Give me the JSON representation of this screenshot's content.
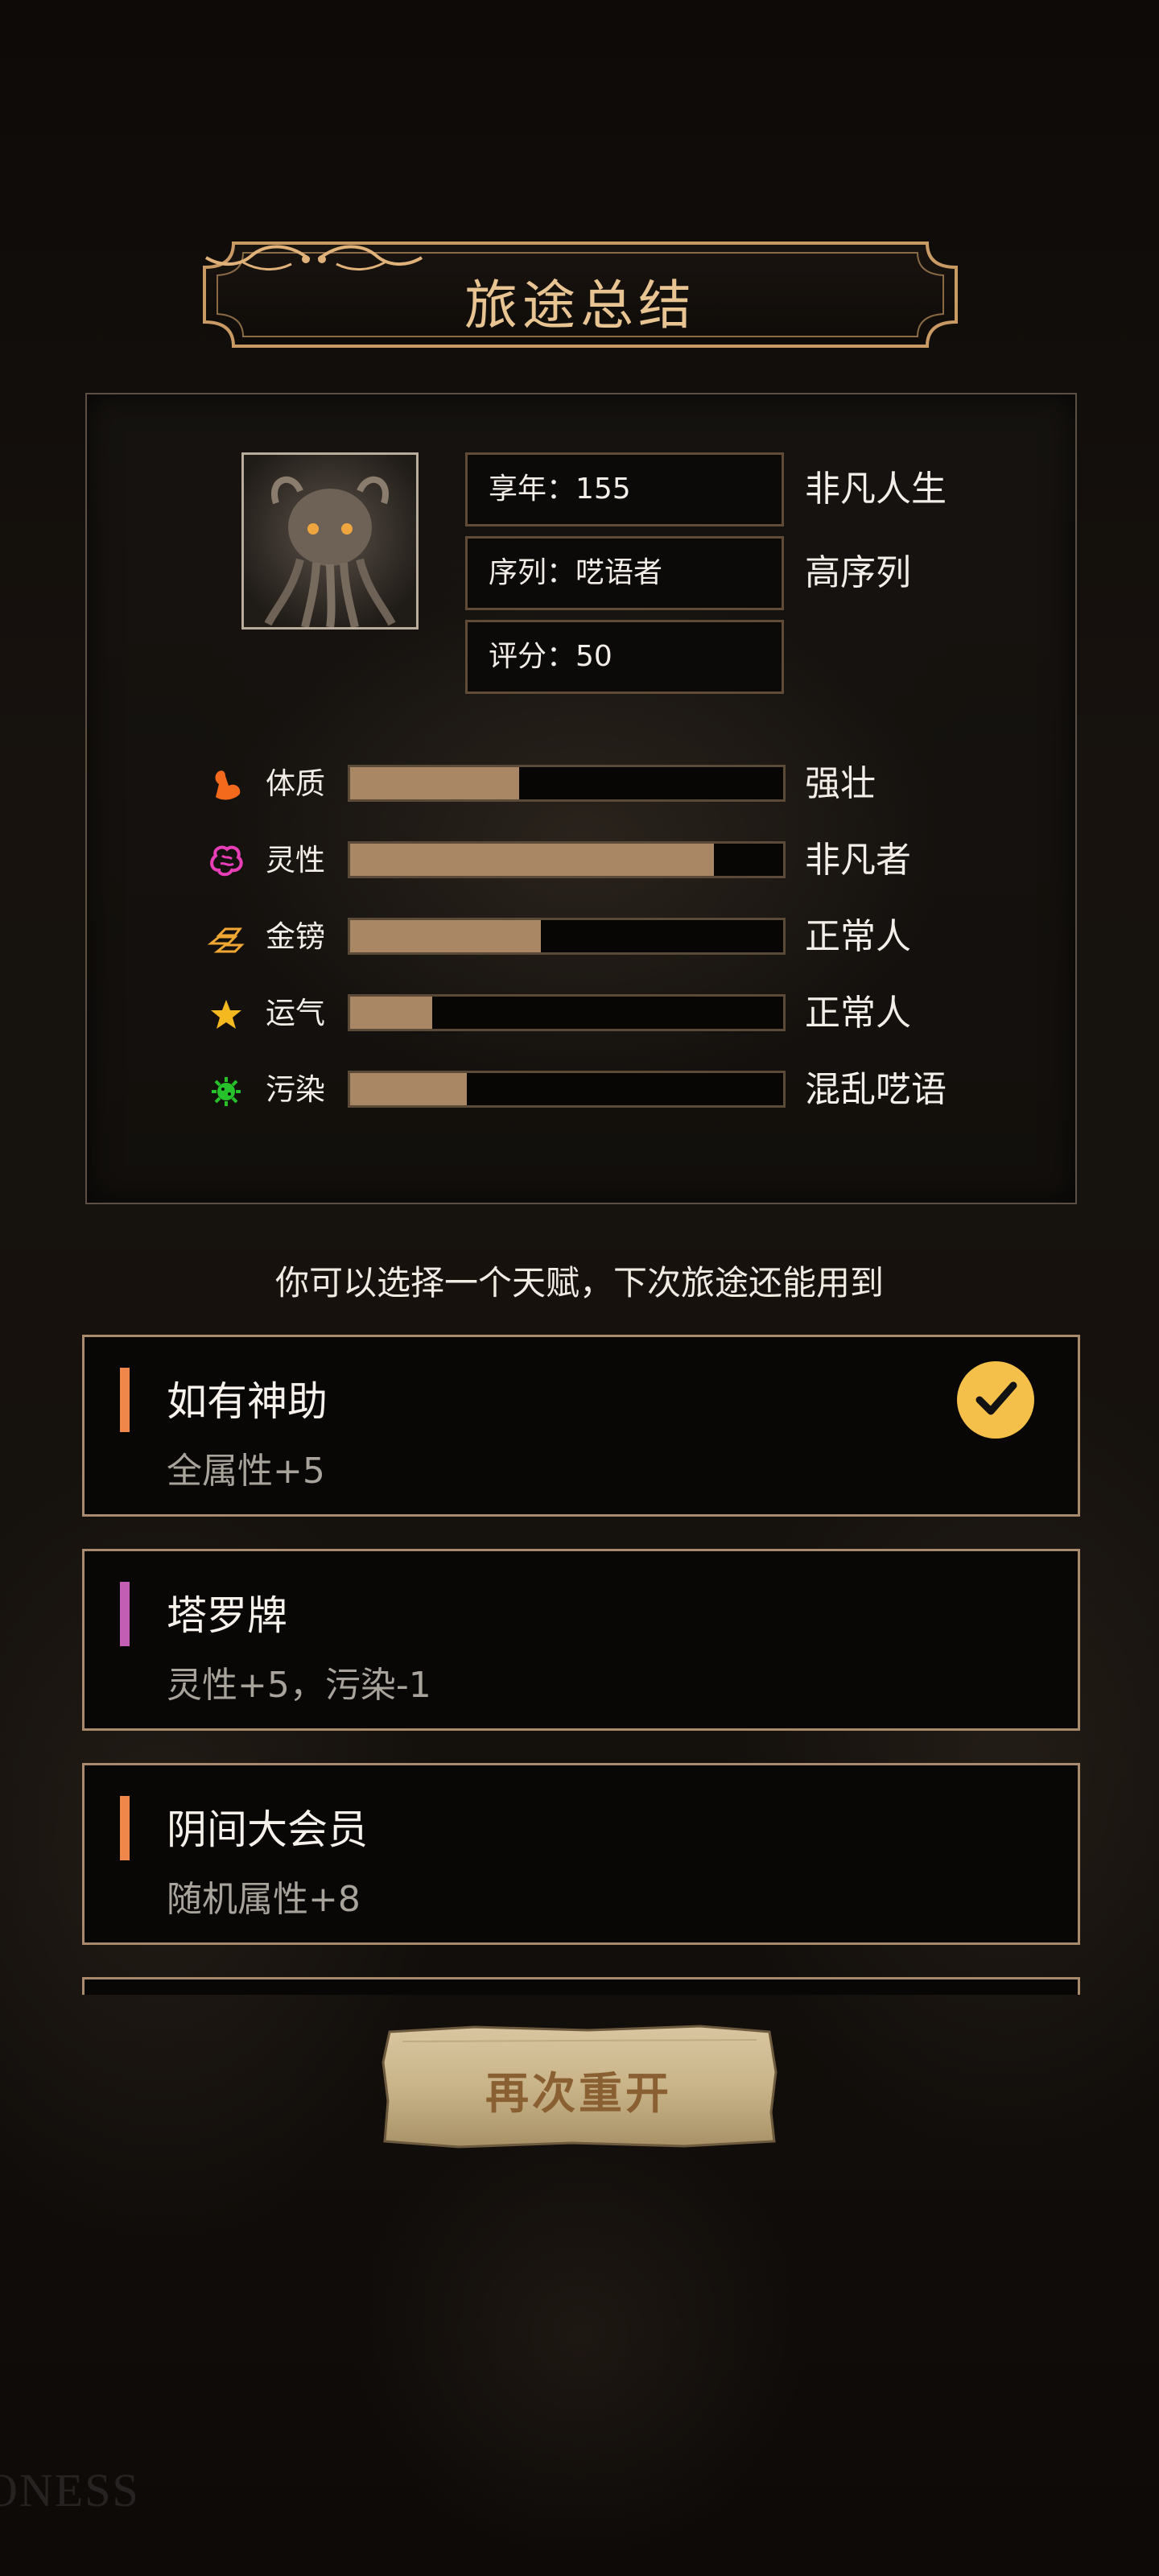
{
  "summary_title": "旅途总结",
  "character": {
    "avatar_icon": "cthulhu-portrait-icon",
    "info": [
      {
        "label": "享年：155",
        "desc": "非凡人生"
      },
      {
        "label": "序列：呓语者",
        "desc": "高序列"
      },
      {
        "label": "评分：50",
        "desc": ""
      }
    ]
  },
  "stats": [
    {
      "icon": "muscle-arm-icon",
      "icon_color": "#f46a1d",
      "label": "体质",
      "fill": 0.39,
      "desc": "强壮"
    },
    {
      "icon": "brain-icon",
      "icon_color": "#e83fb8",
      "label": "灵性",
      "fill": 0.84,
      "desc": "非凡者"
    },
    {
      "icon": "gold-bars-icon",
      "icon_color": "#f0a832",
      "label": "金镑",
      "fill": 0.44,
      "desc": "正常人"
    },
    {
      "icon": "star-icon",
      "icon_color": "#f3b91e",
      "label": "运气",
      "fill": 0.19,
      "desc": "正常人"
    },
    {
      "icon": "virus-icon",
      "icon_color": "#27c22b",
      "label": "污染",
      "fill": 0.27,
      "desc": "混乱呓语"
    }
  ],
  "prompt": "你可以选择一个天赋，下次旅途还能用到",
  "talents": [
    {
      "name": "如有神助",
      "desc": "全属性+5",
      "accent": "#f0874a",
      "selected": true
    },
    {
      "name": "塔罗牌",
      "desc": "灵性+5，污染-1",
      "accent": "#c25fb5",
      "selected": false
    },
    {
      "name": "阴间大会员",
      "desc": "随机属性+8",
      "accent": "#f0874a",
      "selected": false
    },
    {
      "name": "",
      "desc": "",
      "accent": "#f0874a",
      "selected": false
    }
  ],
  "restart_label": "再次重开",
  "watermark": "ONESS"
}
